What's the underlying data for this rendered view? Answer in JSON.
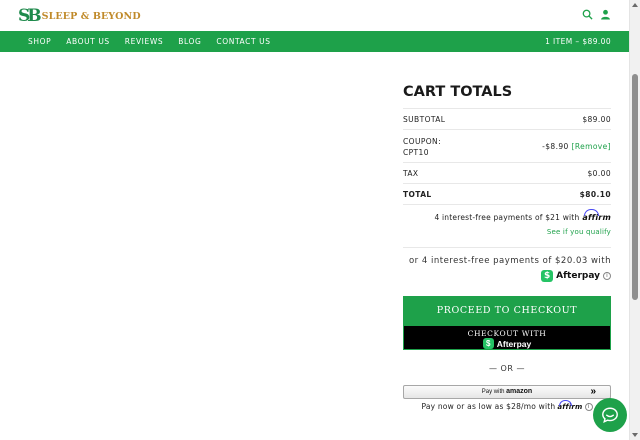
{
  "header": {
    "logo_mark": "SB",
    "logo_text": "SLEEP & BEYOND"
  },
  "nav": {
    "items": [
      "SHOP",
      "ABOUT US",
      "REVIEWS",
      "BLOG",
      "CONTACT US"
    ],
    "cart_summary": "1 ITEM – $89.00"
  },
  "cart_totals": {
    "title": "CART TOTALS",
    "subtotal_label": "SUBTOTAL",
    "subtotal_value": "$89.00",
    "coupon_label_1": "COUPON:",
    "coupon_label_2": "CPT10",
    "coupon_value": "-$8.90",
    "coupon_remove": "[Remove]",
    "tax_label": "TAX",
    "tax_value": "$0.00",
    "total_label": "TOTAL",
    "total_value": "$80.10"
  },
  "affirm": {
    "text": "4 interest-free payments of $21 with",
    "logo": "affirm",
    "link": "See if you qualify"
  },
  "afterpay": {
    "text": "or 4 interest-free payments of $20.03 with",
    "logo": "Afterpay",
    "badge": "$",
    "info": "i"
  },
  "buttons": {
    "checkout": "PROCEED TO CHECKOUT",
    "afterpay_top": "CHECKOUT WITH",
    "afterpay_word": "Afterpay",
    "or": "— OR —",
    "amazon_pay": "Pay with",
    "amazon_word": "amazon",
    "amazon_chevron": "»"
  },
  "pay_later": {
    "text": "Pay now or as low as $28/mo with",
    "logo": "affirm",
    "info": "i"
  },
  "colors": {
    "brand_green": "#1ea14a",
    "logo_gold": "#c08a2a",
    "afterpay_green": "#25c365"
  },
  "icons": [
    "search-icon",
    "user-icon",
    "chat-icon",
    "info-icon"
  ]
}
